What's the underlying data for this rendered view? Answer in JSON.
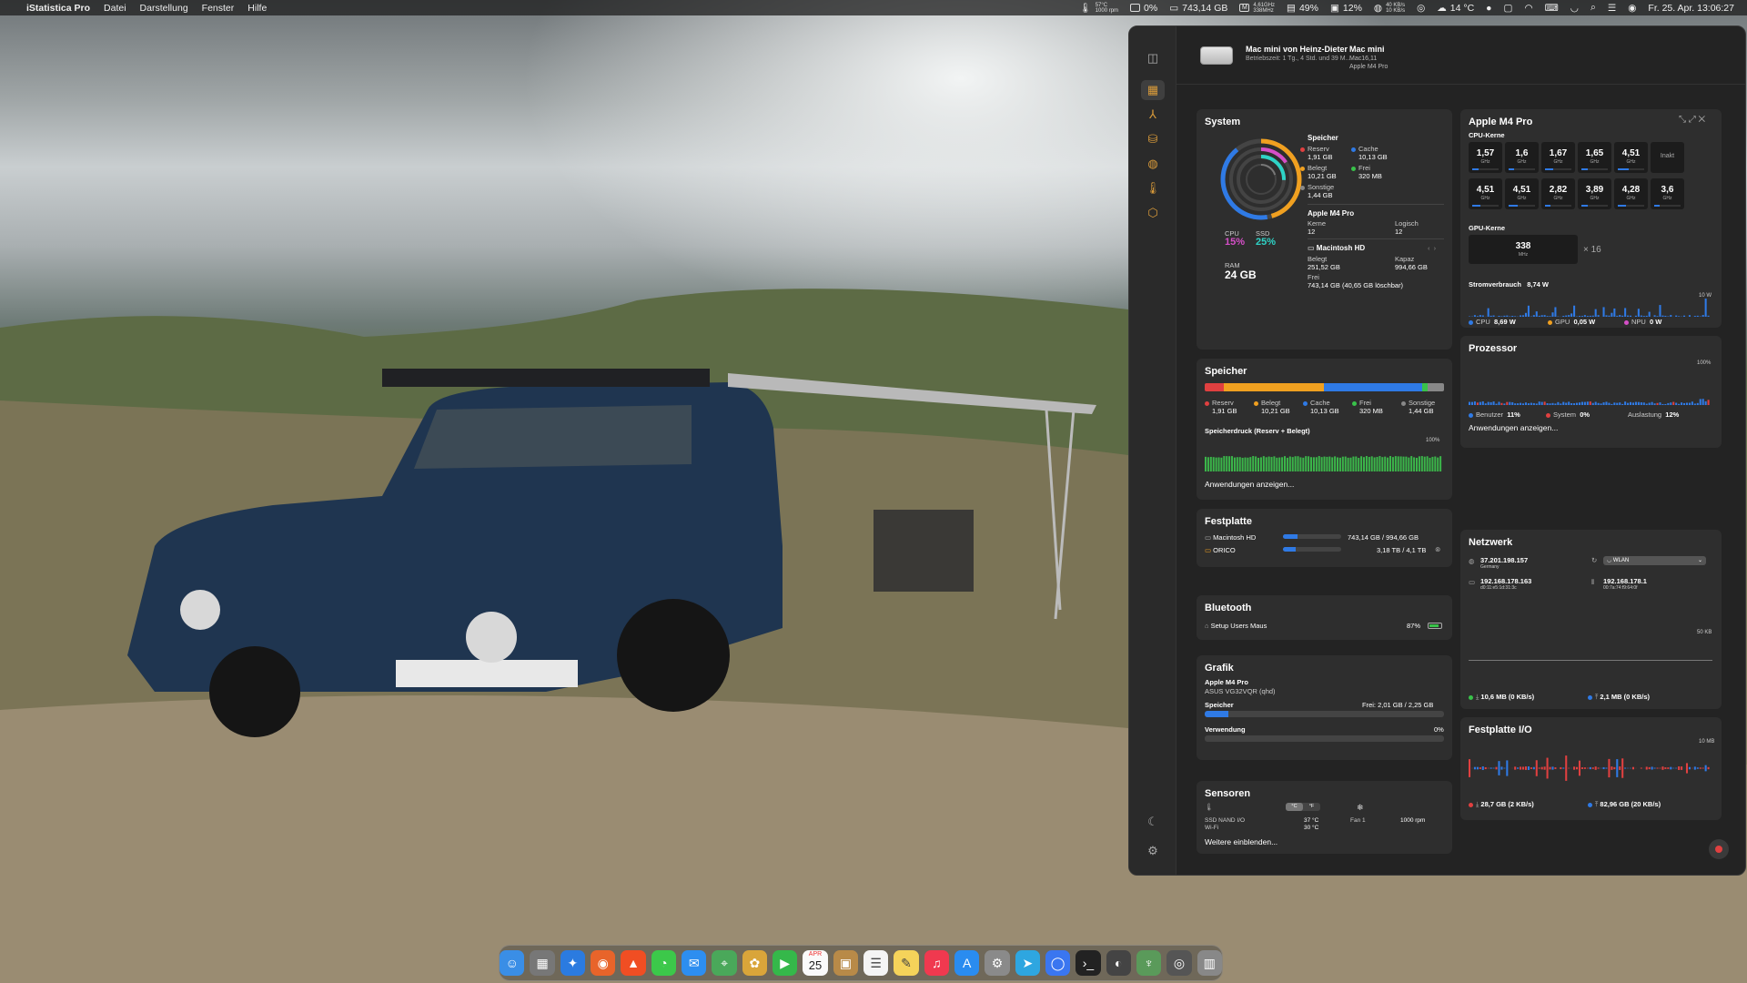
{
  "menubar": {
    "app_name": "iStatistica Pro",
    "menus": [
      "Datei",
      "Darstellung",
      "Fenster",
      "Hilfe"
    ],
    "temp_cpu": "57°C",
    "fan": "1000 rpm",
    "gpu_label": "Apple M4 Pro",
    "gpu_pct": "0%",
    "disk": "743,14 GB",
    "freq_a": "4,61GHz",
    "freq_b": "338MHz",
    "mem_pct": "49%",
    "cpu_pct": "12%",
    "net_up": "40 KB/s",
    "net_down": "10 KB/s",
    "weather": "14 °C",
    "clock": "Fr. 25. Apr.  13:06:27"
  },
  "header": {
    "name": "Mac mini von Heinz-Dieter",
    "uptime": "Betriebszeit: 1 Tg., 4 Std. und 39 M...",
    "model": "Mac mini",
    "model_id": "Mac16,11",
    "chip": "Apple M4 Pro"
  },
  "system": {
    "title": "System",
    "speicher_title": "Speicher",
    "reserv_label": "Reserv",
    "reserv": "1,91 GB",
    "cache_label": "Cache",
    "cache": "10,13 GB",
    "belegt_label": "Belegt",
    "belegt": "10,21 GB",
    "frei_label": "Frei",
    "frei": "320 MB",
    "sonstige_label": "Sonstige",
    "sonstige": "1,44 GB",
    "cpu_label": "CPU",
    "cpu": "15%",
    "ssd_label": "SSD",
    "ssd": "25%",
    "ram_label": "RAM",
    "ram": "24 GB",
    "chip_title": "Apple M4 Pro",
    "kerne_label": "Kerne",
    "kerne": "12",
    "logisch_label": "Logisch",
    "logisch": "12",
    "disk_title": "Macintosh HD",
    "disk_belegt_label": "Belegt",
    "disk_belegt": "251,52 GB",
    "disk_kapaz_label": "Kapaz",
    "disk_kapaz": "994,66 GB",
    "disk_frei_label": "Frei",
    "disk_frei": "743,14 GB (40,65 GB löschbar)"
  },
  "cpu_card": {
    "title": "Apple M4 Pro",
    "cores_title": "CPU-Kerne",
    "cores_row1": [
      {
        "v": "1,57",
        "u": "GHz",
        "p": 0.25
      },
      {
        "v": "1,6",
        "u": "GHz",
        "p": 0.2
      },
      {
        "v": "1,67",
        "u": "GHz",
        "p": 0.3
      },
      {
        "v": "1,65",
        "u": "GHz",
        "p": 0.25
      },
      {
        "v": "4,51",
        "u": "GHz",
        "p": 0.4
      },
      {
        "v": "Inakt",
        "u": "",
        "p": 0
      }
    ],
    "cores_row2": [
      {
        "v": "4,51",
        "u": "GHz",
        "p": 0.3
      },
      {
        "v": "4,51",
        "u": "GHz",
        "p": 0.35
      },
      {
        "v": "2,82",
        "u": "GHz",
        "p": 0.2
      },
      {
        "v": "3,89",
        "u": "GHz",
        "p": 0.25
      },
      {
        "v": "4,28",
        "u": "GHz",
        "p": 0.3
      },
      {
        "v": "3,6",
        "u": "GHz",
        "p": 0.2
      }
    ],
    "gpu_title": "GPU-Kerne",
    "gpu_freq": "338",
    "gpu_unit": "MHz",
    "gpu_count": "× 16",
    "power_title": "Stromverbrauch",
    "power": "8,74 W",
    "power_max": "10 W",
    "cpu_w_label": "CPU",
    "cpu_w": "8,69 W",
    "gpu_w_label": "GPU",
    "gpu_w": "0,05 W",
    "npu_w_label": "NPU",
    "npu_w": "0 W"
  },
  "speicher": {
    "title": "Speicher",
    "labels": [
      "Reserv",
      "Belegt",
      "Cache",
      "Frei",
      "Sonstige"
    ],
    "values": [
      "1,91 GB",
      "10,21 GB",
      "10,13 GB",
      "320 MB",
      "1,44 GB"
    ],
    "druck_title": "Speicherdruck (Reserv + Belegt)",
    "druck_max": "100%",
    "link": "Anwendungen anzeigen..."
  },
  "prozessor": {
    "title": "Prozessor",
    "max": "100%",
    "benutzer_label": "Benutzer",
    "benutzer": "11%",
    "system_label": "System",
    "system": "0%",
    "auslastung_label": "Auslastung",
    "auslastung": "12%",
    "link": "Anwendungen anzeigen..."
  },
  "festplatte": {
    "title": "Festplatte",
    "d1_name": "Macintosh HD",
    "d1_val": "743,14 GB / 994,66 GB",
    "d1_p": 0.25,
    "d2_name": "ORICO",
    "d2_val": "3,18 TB / 4,1 TB",
    "d2_p": 0.22
  },
  "netzwerk": {
    "title": "Netzwerk",
    "public_ip": "37.201.198.157",
    "country": "Germany",
    "iface": "WLAN",
    "local_ip": "192.168.178.163",
    "local_mac": "d0:11:e5:1d:31:3c",
    "router_ip": "192.168.178.1",
    "router_mac": "00:7a:74:f9:64:0f",
    "max": "50 KB",
    "down": "10,6 MB (0 KB/s)",
    "up": "2,1 MB (0 KB/s)"
  },
  "bluetooth": {
    "title": "Bluetooth",
    "device": "Setup Users Maus",
    "battery": "87%",
    "battery_p": 0.87
  },
  "io": {
    "title": "Festplatte I/O",
    "max": "10 MB",
    "read": "28,7 GB (2 KB/s)",
    "write": "82,96 GB (20 KB/s)"
  },
  "grafik": {
    "title": "Grafik",
    "chip": "Apple M4 Pro",
    "display": "ASUS VG32VQR (qhd)",
    "mem_label": "Speicher",
    "mem_val": "Frei: 2,01 GB / 2,25 GB",
    "mem_p": 0.1,
    "use_label": "Verwendung",
    "use_val": "0%"
  },
  "sensoren": {
    "title": "Sensoren",
    "unit_c": "°C",
    "unit_f": "°F",
    "s1": "SSD NAND I/O",
    "s1v": "37 °C",
    "s2": "Wi-Fi",
    "s2v": "30 °C",
    "fan": "Fan 1",
    "fan_v": "1000 rpm",
    "link": "Weitere einblenden..."
  },
  "dock": {
    "items": [
      "finder-icon",
      "launchpad-icon",
      "safari-icon",
      "firefox-icon",
      "brave-icon",
      "messages-icon",
      "mail-icon",
      "maps-icon",
      "photos-icon",
      "facetime-icon",
      "calendar-icon",
      "notes-box-icon",
      "reminders-icon",
      "notes-icon",
      "music-icon",
      "appstore-icon",
      "settings-icon",
      "telegram-icon",
      "signal-icon",
      "terminal-icon",
      "istat-icon",
      "vpn-icon",
      "compass-icon",
      "trash-icon"
    ],
    "calendar_month": "APR",
    "calendar_day": "25"
  }
}
